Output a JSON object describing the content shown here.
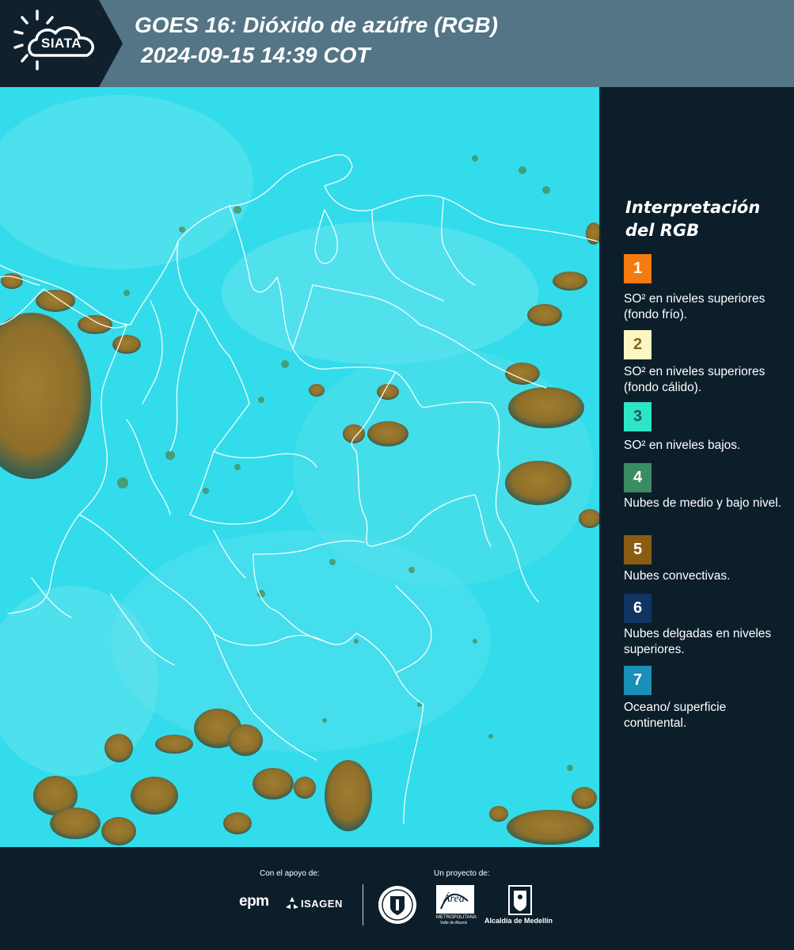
{
  "header": {
    "logo_text": "SIATA",
    "title_line1": "GOES 16: Dióxido de azúfre (RGB)",
    "title_line2": "2024-09-15 14:39 COT",
    "logo_icon": "sun-cloud-icon"
  },
  "map": {
    "description_icon": "satellite-map",
    "ocean_color": "#33dceb",
    "cloud_color": "#9c7a2e",
    "border_color": "#ffffff"
  },
  "legend": {
    "title": "Interpretación del RGB",
    "items": [
      {
        "number": "1",
        "color": "#f47b0f",
        "text_color": "#ffffff",
        "label": "SO² en niveles superiores (fondo frío)."
      },
      {
        "number": "2",
        "color": "#fdf5c2",
        "text_color": "#7a6a2a",
        "label": "SO² en niveles superiores (fondo cálido)."
      },
      {
        "number": "3",
        "color": "#2de6c6",
        "text_color": "#1a5d57",
        "label": "SO² en niveles bajos."
      },
      {
        "number": "4",
        "color": "#3c8c62",
        "text_color": "#ffffff",
        "label": "Nubes de medio y bajo nivel."
      },
      {
        "number": "5",
        "color": "#8a5c13",
        "text_color": "#ffffff",
        "label": "Nubes convectivas."
      },
      {
        "number": "6",
        "color": "#113563",
        "text_color": "#ffffff",
        "label": "Nubes delgadas en niveles superiores."
      },
      {
        "number": "7",
        "color": "#1a8fb8",
        "text_color": "#ffffff",
        "label": "Oceano/ superficie continental."
      }
    ]
  },
  "footer": {
    "support_label": "Con el apoyo de:",
    "project_label": "Un proyecto de:",
    "epm": "epm",
    "isagen": "ISAGEN",
    "metropolitana": "METROPOLITANA",
    "metro_sub": "Valle de Aburrá",
    "area": "Área",
    "alcaldia": "Alcaldía de Medellín"
  }
}
